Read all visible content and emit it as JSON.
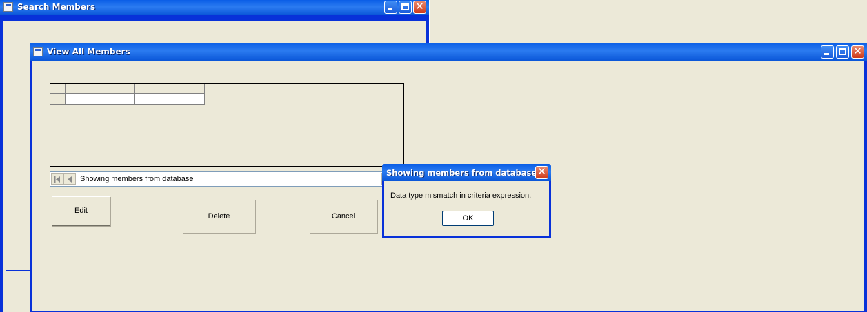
{
  "search_window": {
    "title": "Search Members"
  },
  "view_window": {
    "title": "View All Members",
    "data_control": {
      "caption": "Showing members from database"
    },
    "buttons": {
      "edit": "Edit",
      "delete": "Delete",
      "cancel": "Cancel"
    }
  },
  "message_box": {
    "title": "Showing members from database",
    "message": "Data type mismatch in criteria expression.",
    "ok_label": "OK"
  },
  "icons": {
    "window_icon": "app-window-icon",
    "minimize": "minimize-icon",
    "maximize": "maximize-icon",
    "close": "close-icon",
    "first_record": "first-record-icon",
    "prev_record": "prev-record-icon"
  },
  "colors": {
    "titlebar": "#0a5ee6",
    "client_bg": "#ece9d8",
    "close_button": "#cf3a1a",
    "frame": "#0831d9"
  }
}
